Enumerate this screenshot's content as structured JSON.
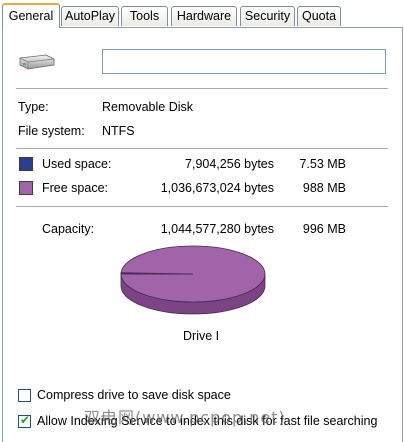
{
  "tabs": [
    {
      "label": "General",
      "active": true
    },
    {
      "label": "AutoPlay",
      "active": false
    },
    {
      "label": "Tools",
      "active": false
    },
    {
      "label": "Hardware",
      "active": false
    },
    {
      "label": "Security",
      "active": false
    },
    {
      "label": "Quota",
      "active": false
    }
  ],
  "drive": {
    "icon": "removable-drive-icon",
    "name_value": ""
  },
  "info": {
    "type_label": "Type:",
    "type_value": "Removable Disk",
    "fs_label": "File system:",
    "fs_value": "NTFS"
  },
  "space": {
    "used_label": "Used space:",
    "used_bytes": "7,904,256 bytes",
    "used_size": "7.53 MB",
    "used_color": "#2a3f8f",
    "free_label": "Free space:",
    "free_bytes": "1,036,673,024 bytes",
    "free_size": "988 MB",
    "free_color": "#a264a8",
    "capacity_label": "Capacity:",
    "capacity_bytes": "1,044,577,280 bytes",
    "capacity_size": "996 MB"
  },
  "pie": {
    "used_fraction": 0.0076,
    "caption": "Drive I"
  },
  "options": {
    "compress_label": "Compress drive to save disk space",
    "compress_checked": false,
    "index_label": "Allow Indexing Service to index this disk for fast file searching",
    "index_checked": true
  },
  "watermark": "双电网(www.pcpop.net)"
}
